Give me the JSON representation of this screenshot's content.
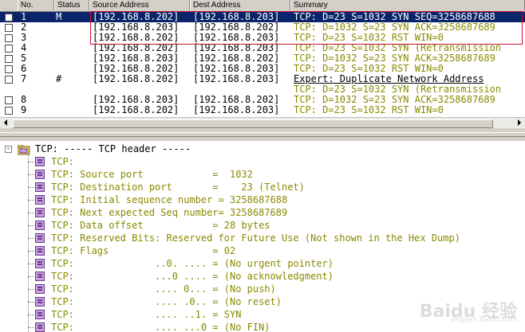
{
  "columns": {
    "no": "No.",
    "status": "Status",
    "source": "Source Address",
    "dest": "Dest Address",
    "summary": "Summary"
  },
  "packets": [
    {
      "no": "1",
      "status": "M",
      "src": "[192.168.8.202]",
      "dst": "[192.168.8.203]",
      "summary": "TCP: D=23 S=1032 SYN SEQ=3258687688",
      "selected": true,
      "style": "white",
      "checkbox": true
    },
    {
      "no": "2",
      "status": "",
      "src": "[192.168.8.203]",
      "dst": "[192.168.8.202]",
      "summary": "TCP: D=1032 S=23 SYN ACK=3258687689",
      "style": "olive",
      "checkbox": true
    },
    {
      "no": "3",
      "status": "",
      "src": "[192.168.8.202]",
      "dst": "[192.168.8.203]",
      "summary": "TCP: D=23 S=1032 RST WIN=0",
      "style": "olive",
      "checkbox": true
    },
    {
      "no": "4",
      "status": "",
      "src": "[192.168.8.202]",
      "dst": "[192.168.8.203]",
      "summary": "TCP: D=23 S=1032 SYN (Retransmission",
      "style": "olive",
      "checkbox": true
    },
    {
      "no": "5",
      "status": "",
      "src": "[192.168.8.203]",
      "dst": "[192.168.8.202]",
      "summary": "TCP: D=1032 S=23 SYN ACK=3258687689",
      "style": "olive",
      "checkbox": true
    },
    {
      "no": "6",
      "status": "",
      "src": "[192.168.8.202]",
      "dst": "[192.168.8.203]",
      "summary": "TCP: D=23 S=1032 RST WIN=0",
      "style": "olive",
      "checkbox": true
    },
    {
      "no": "7",
      "status": "#",
      "src": "[192.168.8.202]",
      "dst": "[192.168.8.203]",
      "summary": "Expert: Duplicate Network Address",
      "style": "expert",
      "checkbox": true
    },
    {
      "no": "",
      "status": "",
      "src": "",
      "dst": "",
      "summary": "TCP: D=23 S=1032 SYN (Retransmission",
      "style": "olive",
      "checkbox": false
    },
    {
      "no": "8",
      "status": "",
      "src": "[192.168.8.203]",
      "dst": "[192.168.8.202]",
      "summary": "TCP: D=1032 S=23 SYN ACK=3258687689",
      "style": "olive",
      "checkbox": true
    },
    {
      "no": "9",
      "status": "",
      "src": "[192.168.8.202]",
      "dst": "[192.168.8.203]",
      "summary": "TCP: D=23 S=1032 RST WIN=0",
      "style": "olive",
      "checkbox": true
    }
  ],
  "detail": {
    "root_expander": "-",
    "root": "TCP: ----- TCP header -----",
    "lines": [
      "TCP:",
      "TCP: Source port            =  1032",
      "TCP: Destination port       =    23 (Telnet)",
      "TCP: Initial sequence number = 3258687688",
      "TCP: Next expected Seq number= 3258687689",
      "TCP: Data offset            = 28 bytes",
      "TCP: Reserved Bits: Reserved for Future Use (Not shown in the Hex Dump)",
      "TCP: Flags                  = 02",
      "TCP:              ..0. .... = (No urgent pointer)",
      "TCP:              ...0 .... = (No acknowledgment)",
      "TCP:              .... 0... = (No push)",
      "TCP:              .... .0.. = (No reset)",
      "TCP:              .... ..1. = SYN",
      "TCP:              .... ...0 = (No FIN)"
    ]
  },
  "watermark": {
    "logo": "Baidu 经验",
    "url": "jingyan.baidu.com"
  },
  "colors": {
    "olive": "#8a8a00",
    "selection": "#0a246a",
    "highlight": "#c8102e"
  }
}
